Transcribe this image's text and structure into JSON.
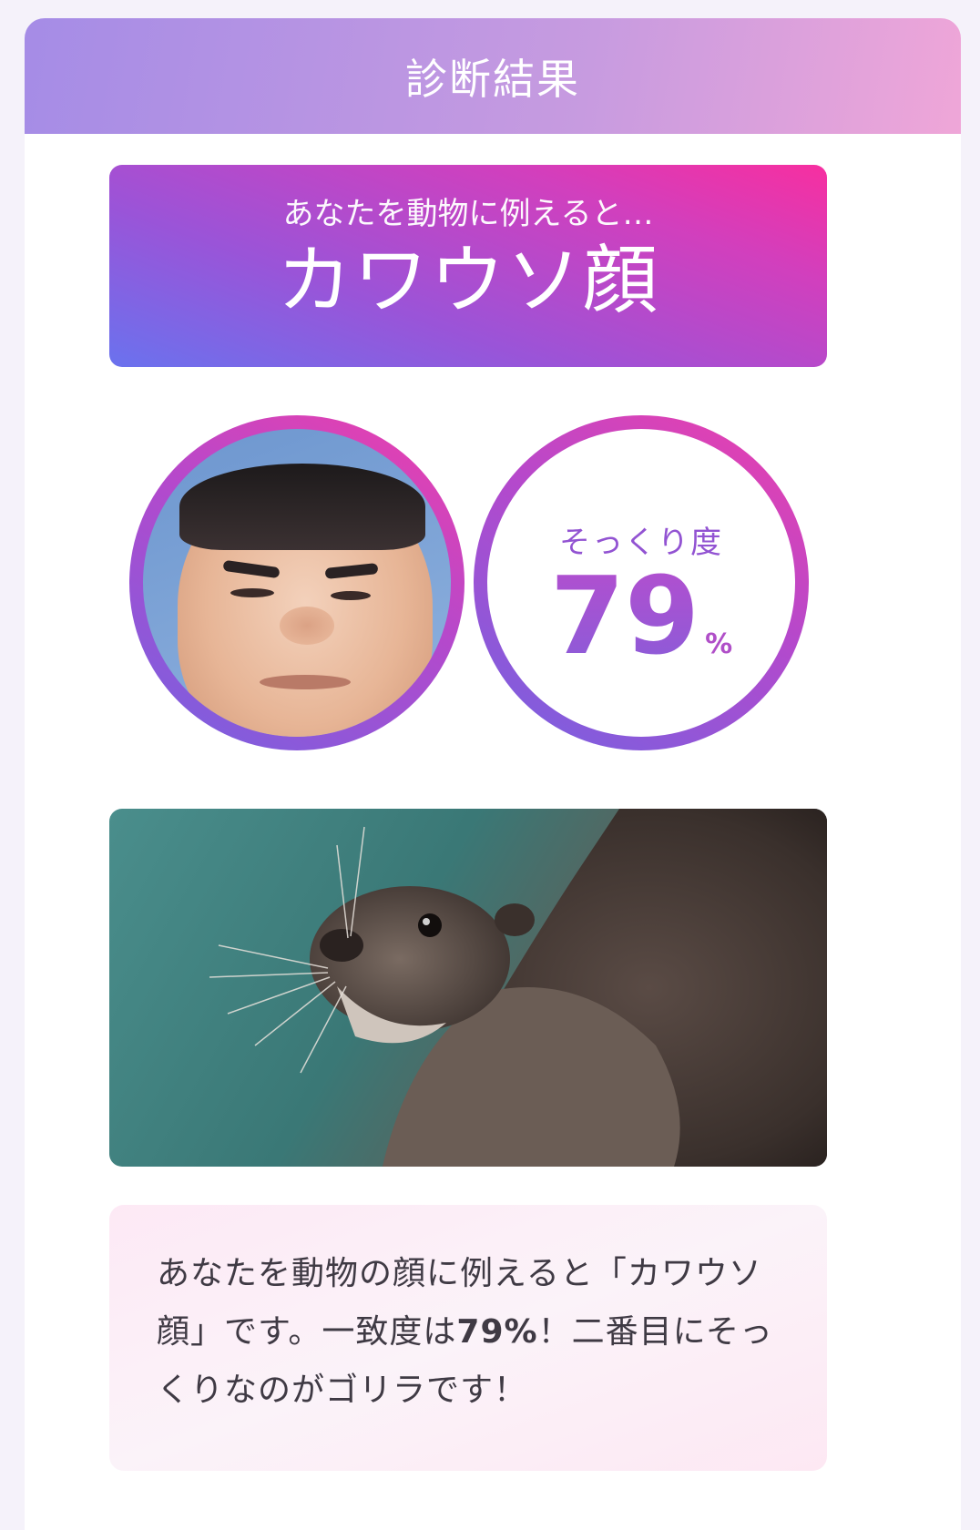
{
  "header": {
    "title": "診断結果"
  },
  "result": {
    "subtitle": "あなたを動物に例えると…",
    "animal_face": "カワウソ顔"
  },
  "similarity": {
    "label": "そっくり度",
    "value": "79",
    "unit": "%"
  },
  "description": {
    "part1": "あなたを動物の顔に例えると「カワウソ顔」です。一致度は",
    "percent": "79%",
    "part2": "！二番目にそっくりなのがゴリラです！"
  },
  "colors": {
    "accent_pink": "#f72fa0",
    "accent_purple": "#9253d2",
    "accent_blue": "#6a72ee"
  }
}
